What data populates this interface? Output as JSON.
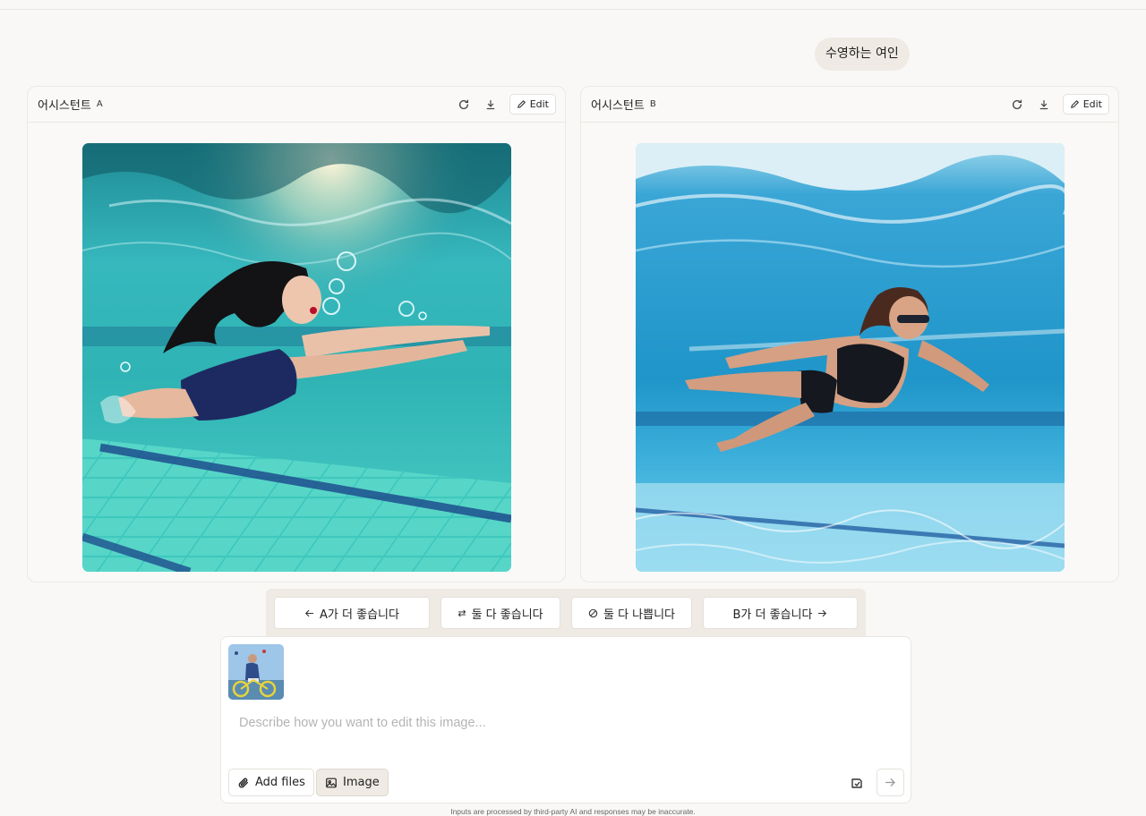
{
  "conversation": {
    "user_prompt": "수영하는 여인"
  },
  "panels": [
    {
      "title": "어시스턴트",
      "letter": "A",
      "edit_label": "Edit",
      "image_subject": "woman in navy swimsuit swimming underwater in turquoise pool with bubbles"
    },
    {
      "title": "어시스턴트",
      "letter": "B",
      "edit_label": "Edit",
      "image_subject": "woman in black bikini and goggles swimming underwater in blue pool"
    }
  ],
  "votes": {
    "a_better": "A가 더 좋습니다",
    "both_good": "둘 다 좋습니다",
    "both_bad": "둘 다 나쁩니다",
    "b_better": "B가 더 좋습니다"
  },
  "composer": {
    "placeholder": "Describe how you want to edit this image...",
    "add_files_label": "Add files",
    "image_label": "Image"
  },
  "footer": {
    "disclaimer": "Inputs are processed by third-party AI and responses may be inaccurate."
  },
  "colors": {
    "background": "#f9f8f6",
    "bubble": "#efebe4",
    "pool_turquoise": "#3fc1c4",
    "pool_blue": "#2aa5d6"
  },
  "icons": [
    "refresh-icon",
    "download-icon",
    "pencil-icon",
    "arrow-left-icon",
    "swap-icon",
    "slash-circle-icon",
    "arrow-right-icon",
    "paperclip-icon",
    "image-icon",
    "stencil-icon",
    "send-arrow-icon"
  ]
}
